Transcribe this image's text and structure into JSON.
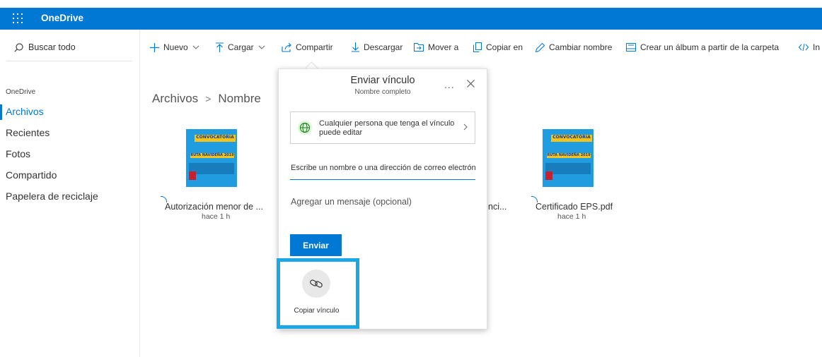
{
  "app": {
    "name": "OneDrive"
  },
  "sidebar": {
    "search_label": "Buscar todo",
    "section_label": "OneDrive",
    "items": [
      {
        "label": "Archivos",
        "active": true
      },
      {
        "label": "Recientes"
      },
      {
        "label": "Fotos"
      },
      {
        "label": "Compartido"
      },
      {
        "label": "Papelera de reciclaje"
      }
    ]
  },
  "toolbar": {
    "new": "Nuevo",
    "upload": "Cargar",
    "share": "Compartir",
    "download": "Descargar",
    "move": "Mover a",
    "copy": "Copiar en",
    "rename": "Cambiar nombre",
    "album": "Crear un álbum a partir de la carpeta",
    "embed": "In"
  },
  "breadcrumb": {
    "root": "Archivos",
    "current": "Nombre"
  },
  "files": [
    {
      "name": "Autorización menor de ...",
      "time": "hace 1 h",
      "thumb_title": "CONVOCATORIA",
      "thumb_sub": "RUTA NAVIDEÑA 2019"
    },
    {
      "name": "nci...",
      "time": ""
    },
    {
      "name": "Certificado EPS.pdf",
      "time": "hace 1 h",
      "thumb_title": "CONVOCATORIA",
      "thumb_sub": "RUTA NAVIDEÑA 2019"
    }
  ],
  "dialog": {
    "title": "Enviar vínculo",
    "subtitle": "Nombre completo",
    "more": "...",
    "permission": "Cualquier persona que tenga el vínculo puede editar",
    "to_placeholder": "Escribe un nombre o una dirección de correo electrónico",
    "message_placeholder": "Agregar un mensaje (opcional)",
    "send": "Enviar",
    "copy_link": "Copiar vínculo"
  },
  "colors": {
    "brand": "#0078d4",
    "highlight": "#1aa7e6"
  }
}
